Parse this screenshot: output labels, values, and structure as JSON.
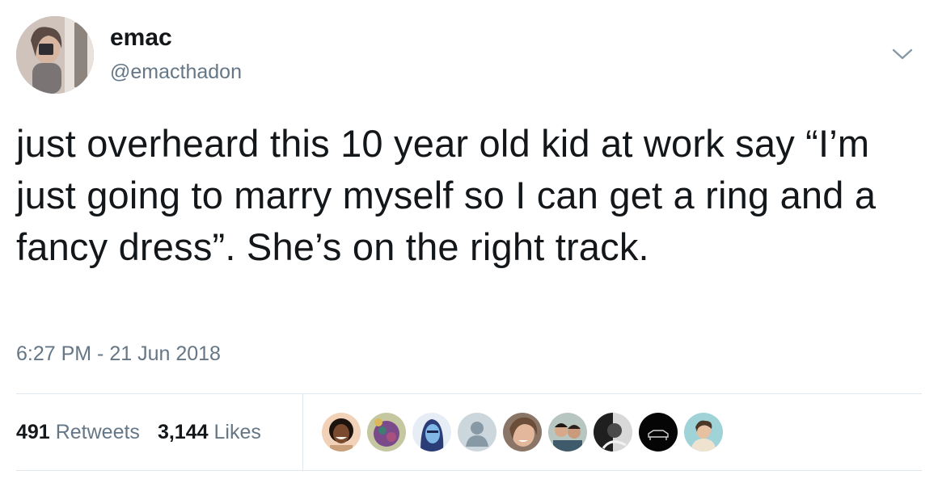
{
  "user": {
    "display_name": "emac",
    "handle": "@emacthadon",
    "avatar_icon": "profile-photo"
  },
  "menu_icon": "chevron-down-icon",
  "tweet": {
    "text": "just overheard this 10 year old kid at work say “I’m just going to marry myself so I can get a ring and a fancy dress”. She’s on the right track.",
    "timestamp": "6:27 PM - 21 Jun 2018"
  },
  "stats": {
    "retweets_count": "491",
    "retweets_label": "Retweets",
    "likes_count": "3,144",
    "likes_label": "Likes"
  },
  "colors": {
    "text_primary": "#14171a",
    "text_secondary": "#657786",
    "divider": "#e1e8ed"
  }
}
